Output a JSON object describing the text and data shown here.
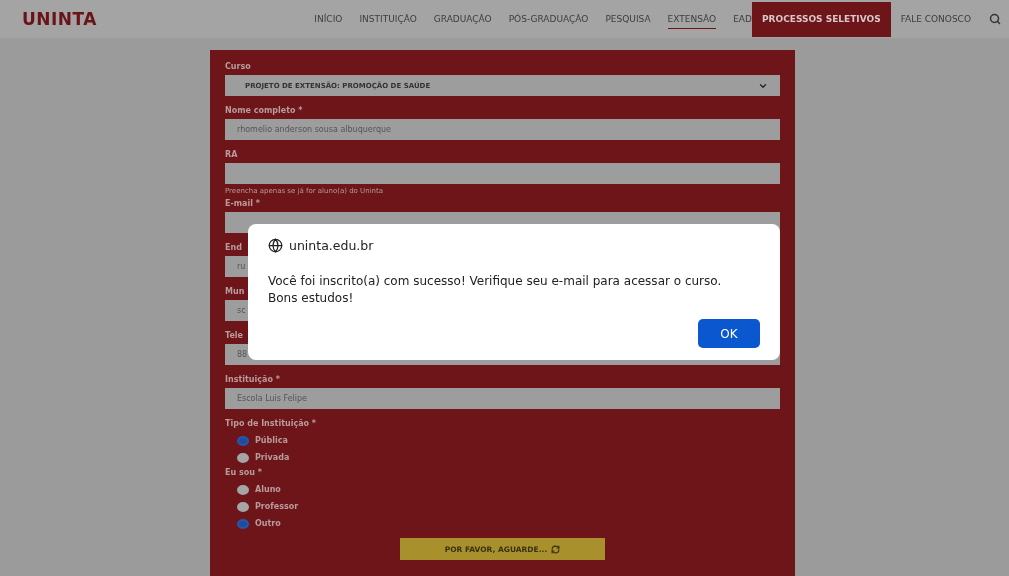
{
  "nav": {
    "logo": "UNINTA",
    "items": [
      {
        "label": "INÍCIO",
        "selected": false,
        "kind": "link"
      },
      {
        "label": "INSTITUIÇÃO",
        "selected": false,
        "kind": "link"
      },
      {
        "label": "GRADUAÇÃO",
        "selected": false,
        "kind": "link"
      },
      {
        "label": "PÓS-GRADUAÇÃO",
        "selected": false,
        "kind": "link"
      },
      {
        "label": "PESQUISA",
        "selected": false,
        "kind": "link"
      },
      {
        "label": "EXTENSÃO",
        "selected": true,
        "kind": "link"
      },
      {
        "label": "EAD",
        "selected": false,
        "kind": "link"
      },
      {
        "label": "PROCESSOS SELETIVOS",
        "selected": false,
        "kind": "highlight"
      },
      {
        "label": "FALE CONOSCO",
        "selected": false,
        "kind": "link"
      }
    ]
  },
  "form": {
    "fields": [
      {
        "kind": "select",
        "label": "Curso",
        "value": "PROJETO DE EXTENSÃO: PROMOÇÃO DE SAÚDE"
      },
      {
        "kind": "text",
        "label": "Nome completo *",
        "value": "rhomelio anderson sousa albuquerque"
      },
      {
        "kind": "text",
        "label": "RA",
        "hint": "Preencha apenas se já for aluno(a) do Uninta"
      },
      {
        "kind": "text",
        "label": "E-mail *"
      },
      {
        "kind": "text",
        "label": "End",
        "value": "ru"
      },
      {
        "kind": "text",
        "label": "Mun",
        "value": "sc"
      },
      {
        "kind": "text",
        "label": "Tele",
        "value": "88"
      },
      {
        "kind": "text",
        "label": "Instituição *",
        "value": "Escola Luis Felipe"
      },
      {
        "kind": "radio",
        "label": "Tipo de Instituição *",
        "options": [
          {
            "label": "Pública",
            "selected": true
          },
          {
            "label": "Privada",
            "selected": false
          }
        ]
      },
      {
        "kind": "radio",
        "label": "Eu sou *",
        "options": [
          {
            "label": "Aluno",
            "selected": false
          },
          {
            "label": "Professor",
            "selected": false
          },
          {
            "label": "Outro",
            "selected": true
          }
        ]
      }
    ],
    "submit": "POR FAVOR, AGUARDE..."
  },
  "dialog": {
    "origin": "uninta.edu.br",
    "message": "Você foi inscrito(a) com sucesso! Verifique seu e-mail para acessar o curso. Bons estudos!",
    "button": "OK"
  }
}
